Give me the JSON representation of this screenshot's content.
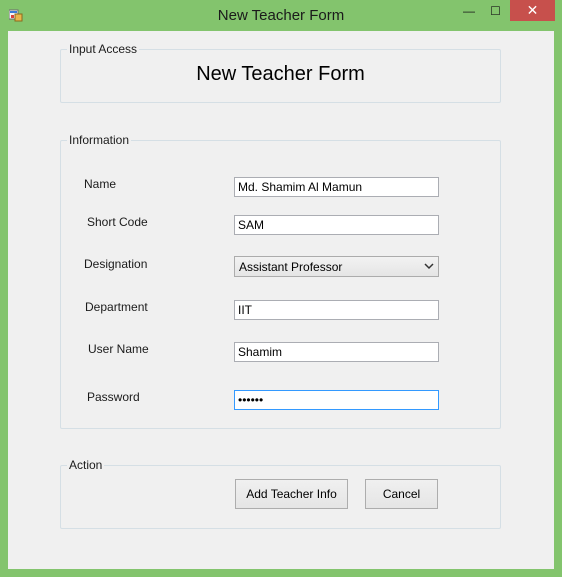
{
  "window": {
    "title": "New Teacher Form",
    "accent_color": "#83c46d",
    "close_color": "#c7504c"
  },
  "titlebar_controls": {
    "minimize_glyph": "—",
    "maximize_glyph": "☐",
    "close_glyph": "✕"
  },
  "input_access": {
    "group_label": "Input Access",
    "heading": "New Teacher Form"
  },
  "information": {
    "group_label": "Information",
    "fields": {
      "name": {
        "label": "Name",
        "value": "Md. Shamim Al Mamun"
      },
      "short_code": {
        "label": "Short Code",
        "value": "SAM"
      },
      "designation": {
        "label": "Designation",
        "value": "Assistant Professor"
      },
      "department": {
        "label": "Department",
        "value": "IIT"
      },
      "user_name": {
        "label": "User Name",
        "value": "Shamim"
      },
      "password": {
        "label": "Password",
        "value": "••••••"
      }
    }
  },
  "action": {
    "group_label": "Action",
    "add_button": "Add Teacher Info",
    "cancel_button": "Cancel"
  }
}
